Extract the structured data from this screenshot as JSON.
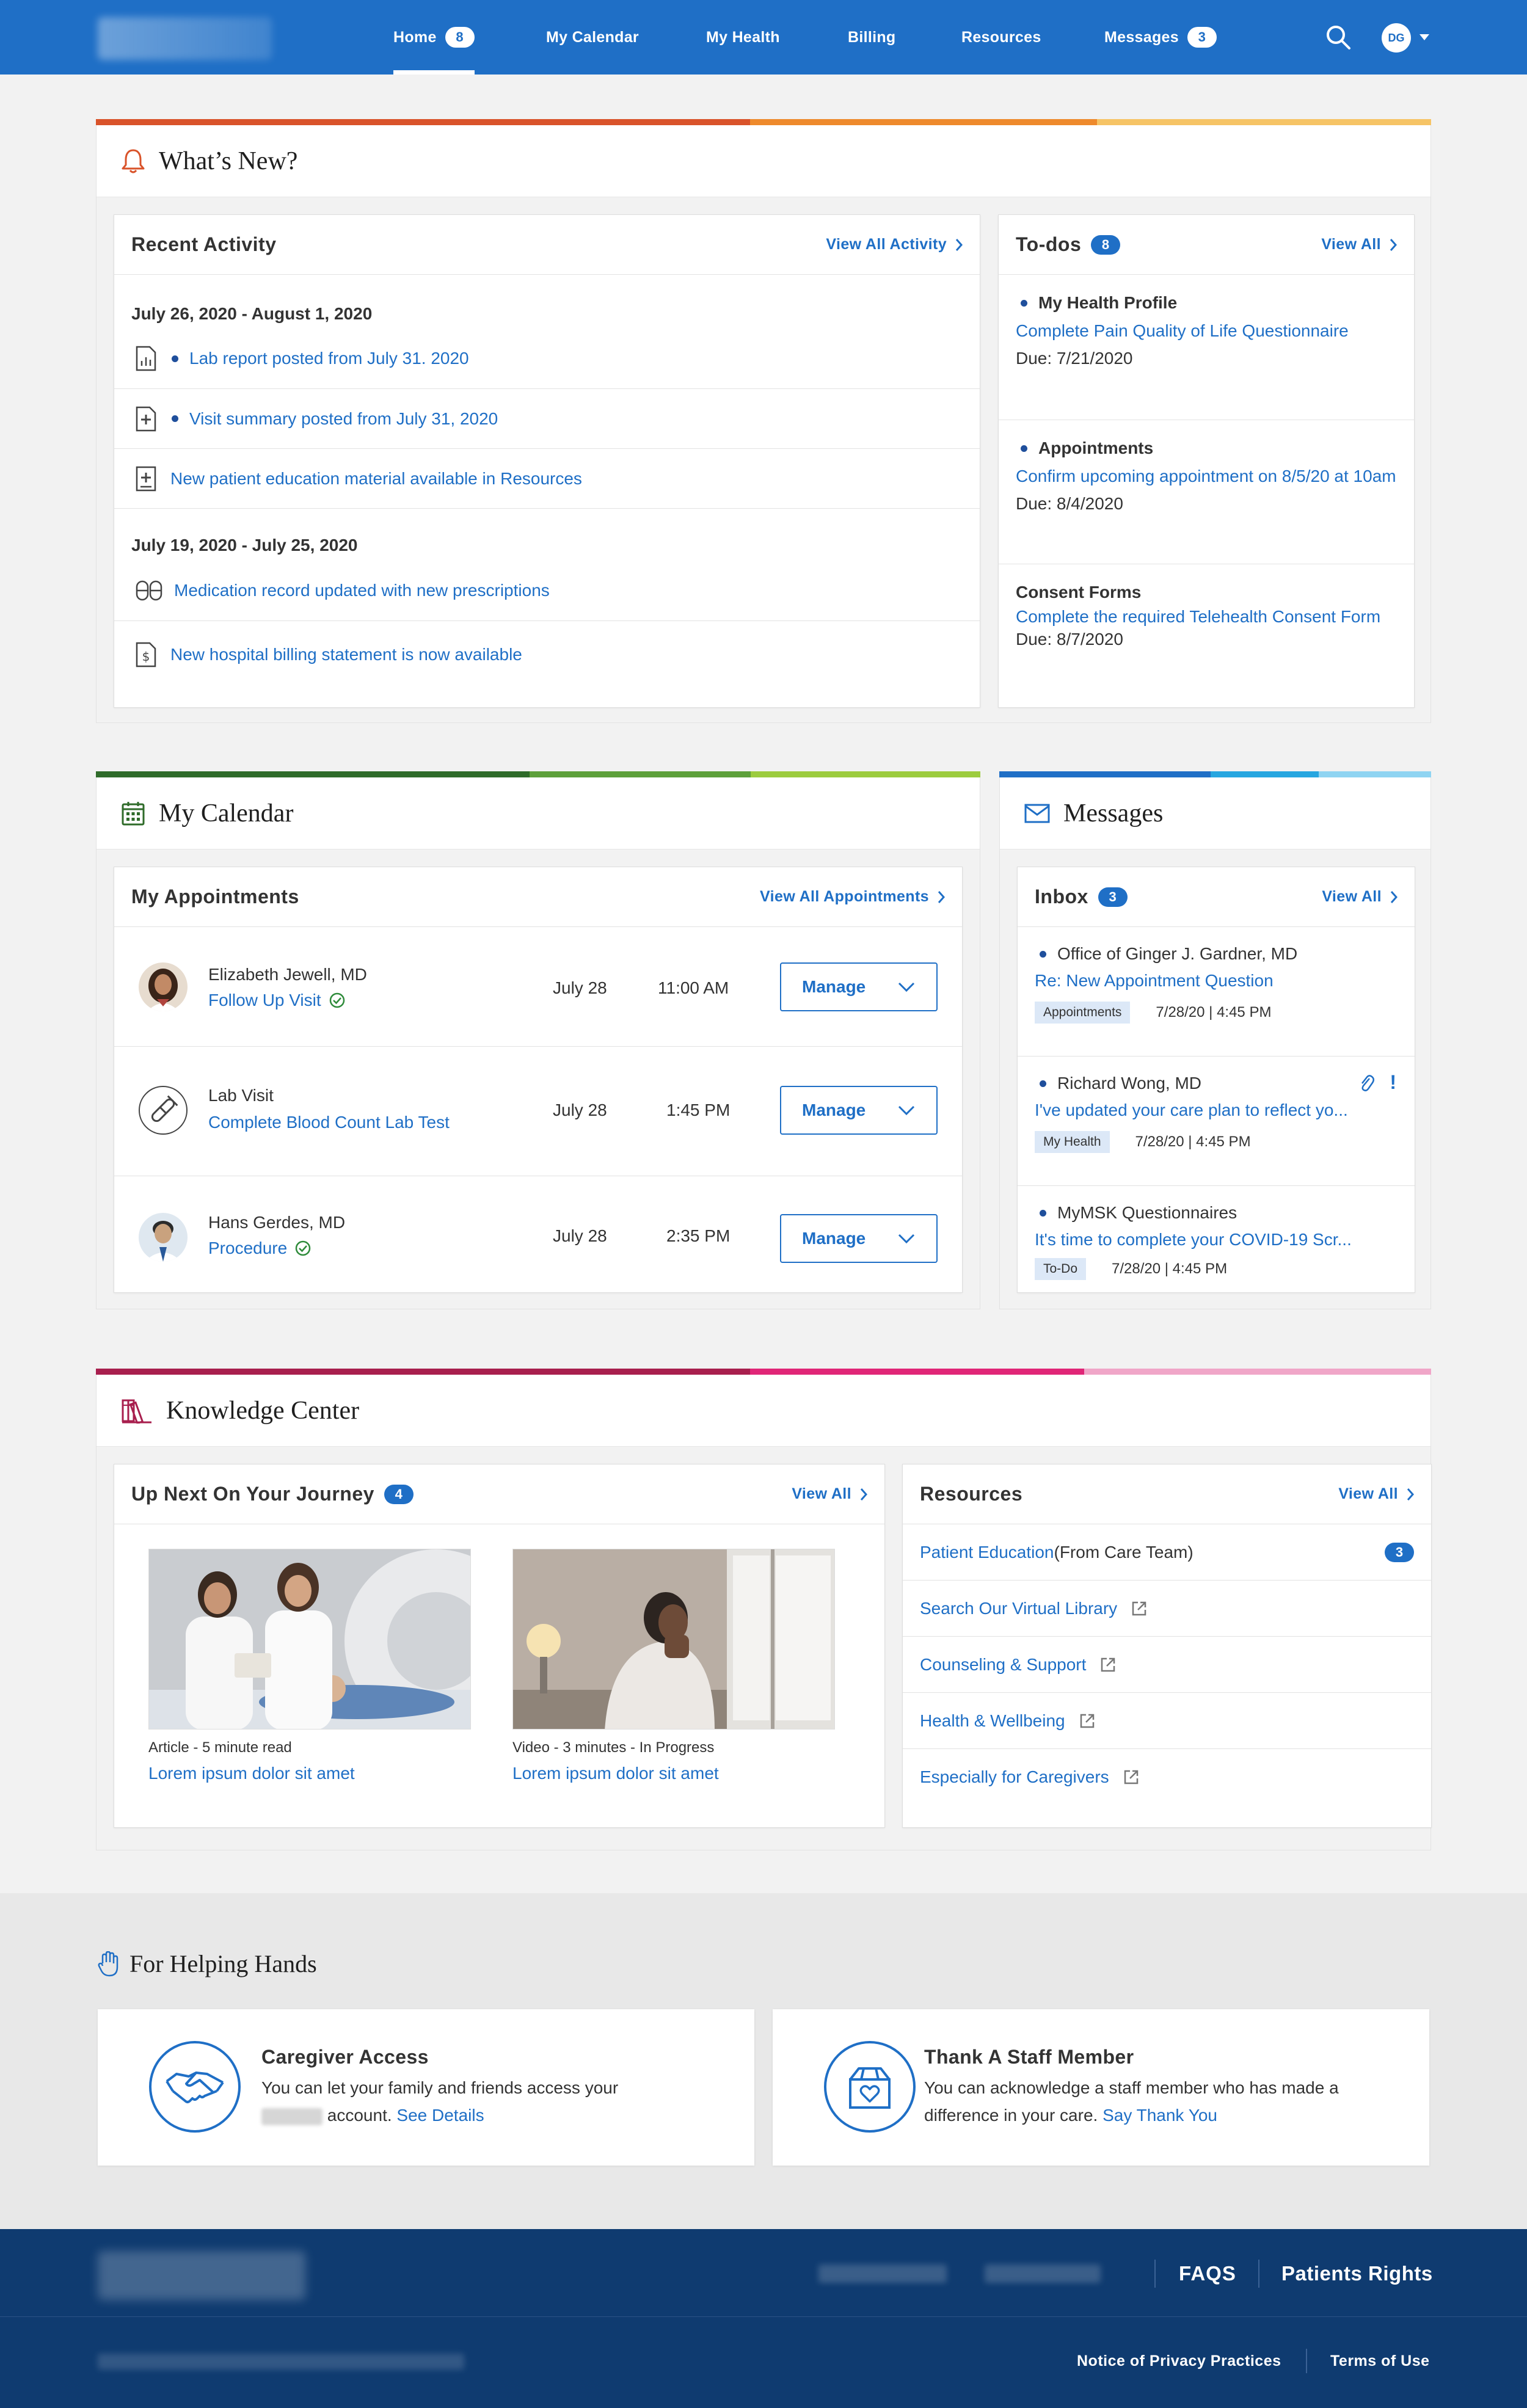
{
  "nav": {
    "items": [
      {
        "label": "Home",
        "badge": "8"
      },
      {
        "label": "My Calendar"
      },
      {
        "label": "My Health"
      },
      {
        "label": "Billing"
      },
      {
        "label": "Resources"
      },
      {
        "label": "Messages",
        "badge": "3"
      }
    ],
    "avatar_initials": "DG",
    "search_icon": "search-icon",
    "caret_icon": "caret-down-icon"
  },
  "whats_new": {
    "title": "What’s New?",
    "icon": "bell-icon",
    "recent_activity": {
      "title": "Recent Activity",
      "view_all": "View All Activity",
      "groups": [
        {
          "date_range": "July 26, 2020 - August 1, 2020",
          "items": [
            {
              "icon": "lab-report-icon",
              "unread": true,
              "text": "Lab report posted from July 31. 2020"
            },
            {
              "icon": "visit-summary-icon",
              "unread": true,
              "text": "Visit summary posted from July 31, 2020"
            },
            {
              "icon": "education-material-icon",
              "unread": false,
              "text": "New patient education material available in Resources"
            }
          ]
        },
        {
          "date_range": "July 19, 2020 - July 25, 2020",
          "items": [
            {
              "icon": "medication-icon",
              "unread": false,
              "text": "Medication record updated with new prescriptions"
            },
            {
              "icon": "billing-statement-icon",
              "unread": false,
              "text": "New hospital billing statement is now available"
            }
          ]
        }
      ]
    },
    "todos": {
      "title": "To-dos",
      "badge": "8",
      "view_all": "View All",
      "items": [
        {
          "category": "My Health Profile",
          "unread": true,
          "link": "Complete Pain Quality of Life Questionnaire",
          "due": "Due: 7/21/2020"
        },
        {
          "category": "Appointments",
          "unread": true,
          "link": "Confirm upcoming appointment on 8/5/20 at 10am",
          "due": "Due: 8/4/2020"
        },
        {
          "category": "Consent Forms",
          "unread": false,
          "link": "Complete the required Telehealth Consent Form",
          "due": "Due: 8/7/2020"
        }
      ]
    }
  },
  "calendar": {
    "title": "My Calendar",
    "icon": "calendar-icon",
    "appointments": {
      "title": "My Appointments",
      "view_all": "View All Appointments",
      "items": [
        {
          "provider": "Elizabeth Jewell, MD",
          "type": "Follow Up Visit",
          "date": "July 28",
          "time": "11:00 AM",
          "manage": "Manage",
          "avatar": "provider-photo-female"
        },
        {
          "provider": "Lab Visit",
          "type": "Complete Blood Count Lab Test",
          "date": "July 28",
          "time": "1:45 PM",
          "manage": "Manage",
          "avatar": "lab-test-icon"
        },
        {
          "provider": "Hans Gerdes, MD",
          "type": "Procedure",
          "date": "July 28",
          "time": "2:35 PM",
          "manage": "Manage",
          "avatar": "provider-photo-male"
        }
      ]
    }
  },
  "messages": {
    "title": "Messages",
    "icon": "envelope-icon",
    "inbox": {
      "title": "Inbox",
      "badge": "3",
      "view_all": "View All",
      "items": [
        {
          "from": "Office of Ginger J. Gardner, MD",
          "subject": "Re: New Appointment Question",
          "tag": "Appointments",
          "timestamp": "7/28/20 | 4:45 PM"
        },
        {
          "from": "Richard Wong, MD",
          "subject": "I've updated your care plan to reflect yo...",
          "tag": "My Health",
          "timestamp": "7/28/20 | 4:45 PM",
          "attachment": true,
          "important": "!"
        },
        {
          "from": "MyMSK Questionnaires",
          "subject": "It's time to complete your COVID-19 Scr...",
          "tag": "To-Do",
          "timestamp": "7/28/20 | 4:45 PM"
        }
      ]
    }
  },
  "knowledge": {
    "title": "Knowledge Center",
    "icon": "books-icon",
    "up_next": {
      "title": "Up Next On Your Journey",
      "badge": "4",
      "view_all": "View All",
      "items": [
        {
          "meta": "Article - 5 minute read",
          "title": "Lorem ipsum dolor sit amet"
        },
        {
          "meta": "Video - 3 minutes - In Progress",
          "title": "Lorem ipsum dolor sit amet"
        }
      ]
    },
    "resources": {
      "title": "Resources",
      "view_all": "View All",
      "items": [
        {
          "label": "Patient Education",
          "suffix": " (From Care Team)",
          "badge": "3"
        },
        {
          "label": "Search Our Virtual Library",
          "external": true
        },
        {
          "label": "Counseling & Support",
          "external": true
        },
        {
          "label": "Health & Wellbeing",
          "external": true
        },
        {
          "label": "Especially for Caregivers",
          "external": true
        }
      ]
    }
  },
  "helping_hands": {
    "title": "For Helping Hands",
    "icon": "raised-hand-icon",
    "cards": [
      {
        "title": "Caregiver Access",
        "text_a": "You can let your family and friends access your",
        "text_b": " account. ",
        "link": "See Details",
        "icon": "handshake-icon"
      },
      {
        "title": "Thank A Staff Member",
        "text_a": "You can acknowledge a staff member who has made a difference in your care. ",
        "link": "Say Thank You",
        "icon": "gift-box-heart-icon"
      }
    ]
  },
  "footer": {
    "faqs": "FAQS",
    "patients_rights": "Patients Rights",
    "privacy": "Notice of Privacy Practices",
    "terms": "Terms of Use"
  },
  "colors": {
    "brand_blue": "#1f6fc6",
    "footer_navy": "#0f3b70",
    "whats_new_bar": [
      "#d9532a",
      "#ee8a2c",
      "#f6c466"
    ],
    "calendar_bar": [
      "#2f6b2a",
      "#5da03a",
      "#9ccc3e"
    ],
    "messages_bar": [
      "#1f6fc6",
      "#27a6e0",
      "#8fd4f2"
    ],
    "knowledge_bar": [
      "#a81f4e",
      "#e02677",
      "#f0a6c8"
    ]
  }
}
